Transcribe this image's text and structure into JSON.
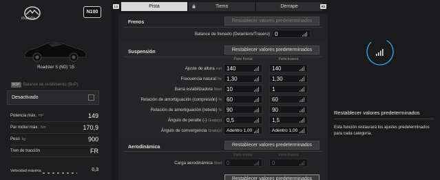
{
  "car": {
    "brand": "mazda",
    "pp": "N100",
    "name": "Roadster S (ND) '15"
  },
  "bop": {
    "tag": "BOP",
    "label": "Balance de rendimiento (BoP)",
    "value": "Desactivado"
  },
  "specs": [
    {
      "label": "Potencia máx.",
      "unit": "HP",
      "value": "149"
    },
    {
      "label": "Par motor máx.",
      "unit": "Nm",
      "value": "170,9"
    },
    {
      "label": "Peso",
      "unit": "kg",
      "value": "900"
    },
    {
      "label": "Tren de tracción",
      "unit": "",
      "value": "FR"
    },
    {
      "label": "Velocidad máxima",
      "unit": "",
      "value": "0,3"
    }
  ],
  "tabs": {
    "left_shoulder": "L1",
    "right_shoulder": "R1",
    "items": [
      {
        "label": "Pista",
        "active": true
      },
      {
        "label": "Tierra",
        "active": false
      },
      {
        "label": "Derrape",
        "active": false
      }
    ]
  },
  "reset_label": "Restablecer valores predeterminados",
  "frenos": {
    "title": "Frenos",
    "balance_label": "Balance de frenado (Delantero/Trasero)",
    "balance_value": "0"
  },
  "suspension": {
    "title": "Suspensión",
    "col_front": "Parte frontal",
    "col_rear": "Parte trasera",
    "rows": [
      {
        "label": "Ajuste de altura",
        "unit": "mm",
        "front": "140",
        "rear": "140"
      },
      {
        "label": "Frecuencia natural",
        "unit": "Hz",
        "front": "1,30",
        "rear": "1,30"
      },
      {
        "label": "Barra estabilizadora",
        "unit": "Nivel",
        "front": "10",
        "rear": "1"
      },
      {
        "label": "Relación de amortiguación (compresión)",
        "unit": "%",
        "front": "60",
        "rear": "60"
      },
      {
        "label": "Relación de amortiguación (rebote)",
        "unit": "%",
        "front": "90",
        "rear": "90"
      },
      {
        "label": "Ángulo de peralte (-)",
        "unit": "Grado(s)",
        "front": "0,5",
        "rear": "1,5"
      },
      {
        "label": "Ángulo de convergencia",
        "unit": "Grado(s)",
        "front": "Adentro 1,00",
        "rear": "Adentro 1,00"
      }
    ]
  },
  "aero": {
    "title": "Aerodinámica",
    "col_front": "Parte frontal",
    "col_rear": "Parte trasera",
    "row_label": "Carga aerodinámica",
    "row_unit": "Nivel",
    "front": "0",
    "rear": "0"
  },
  "info": {
    "title": "Restablecer valores predeterminados",
    "desc": "Esta función restaurará los ajustes predeterminados para cada categoría."
  },
  "colors": {
    "accent": "#2aa7e0",
    "tab_active": "#d9d9d9"
  }
}
